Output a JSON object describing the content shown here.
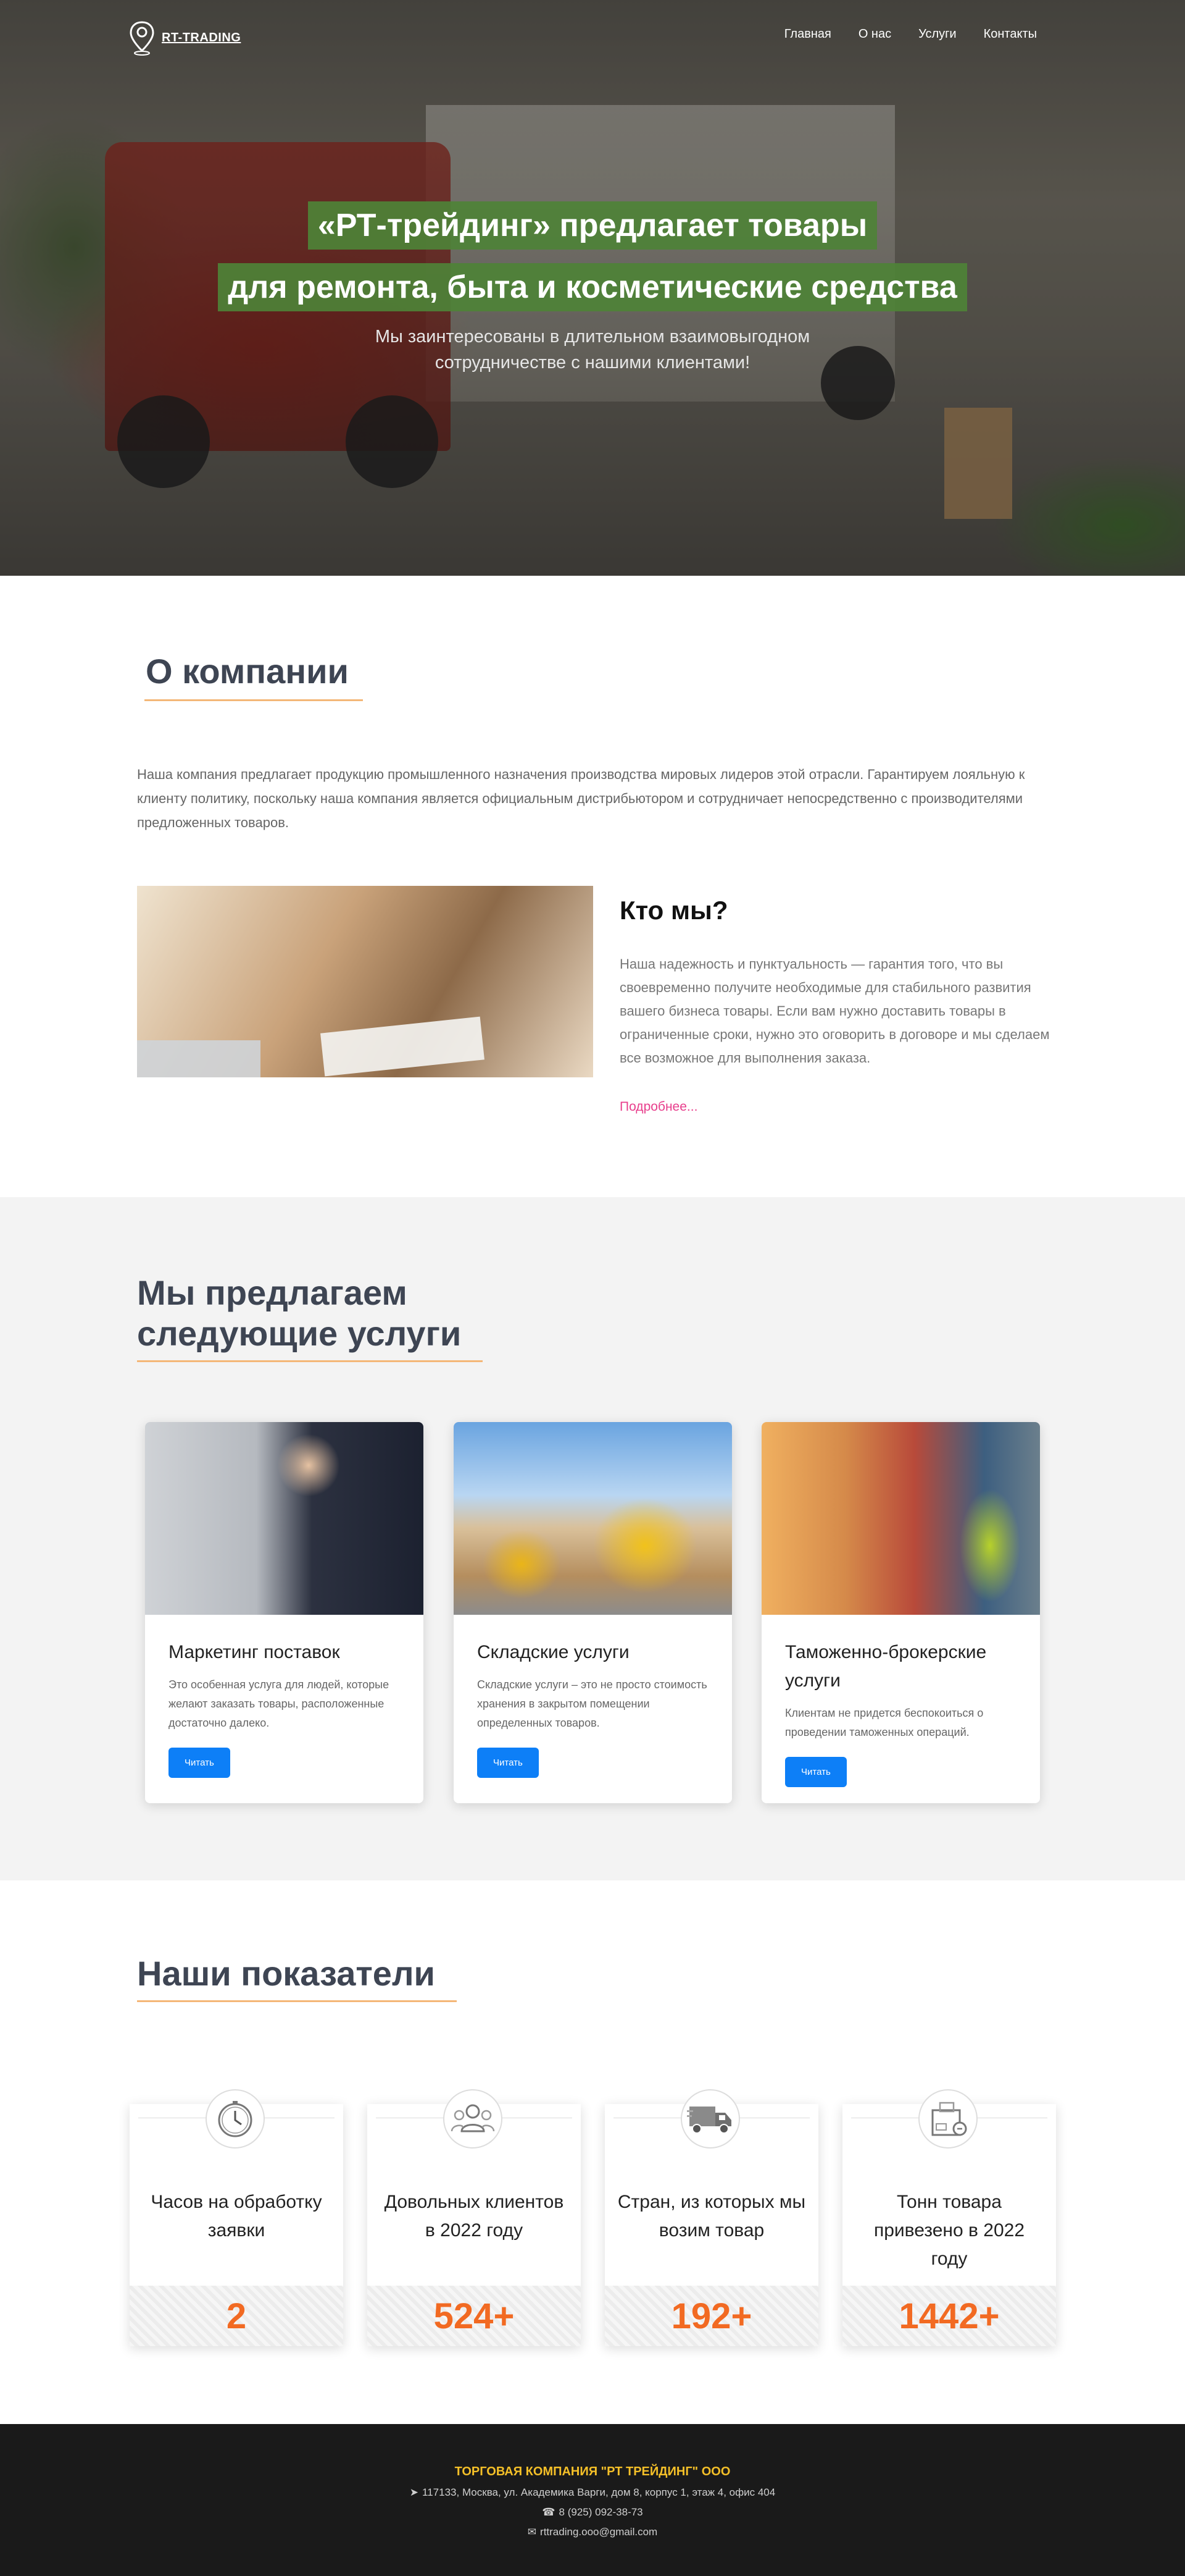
{
  "brand": {
    "name": "RT-TRADING"
  },
  "nav": {
    "items": [
      {
        "label": "Главная"
      },
      {
        "label": "О нас"
      },
      {
        "label": "Услуги"
      },
      {
        "label": "Контакты"
      }
    ]
  },
  "hero": {
    "title_line1": "«РТ-трейдинг» предлагает товары",
    "title_line2": "для ремонта, быта и косметические средства",
    "subtitle": "Мы заинтересованы в длительном взаимовыгодном сотрудничестве с нашими клиентами!"
  },
  "about": {
    "title": "О компании",
    "text": "Наша компания предлагает продукцию промышленного назначения производства мировых лидеров этой отрасли. Гарантируем лояльную к клиенту политику, поскольку наша компания является официальным дистрибьютором и сотрудничает непосредственно с производителями предложенных товаров.",
    "who_title": "Кто мы?",
    "who_text": "Наша надежность и пунктуальность — гарантия того, что вы своевременно получите необходимые для стабильного развития вашего бизнеса товары. Если вам нужно доставить товары в ограниченные сроки, нужно это оговорить в договоре и мы сделаем все возможное для выполнения заказа.",
    "more_label": "Подробнее..."
  },
  "services": {
    "title_line1": "Мы предлагаем",
    "title_line2": "следующие услуги",
    "cards": [
      {
        "title": "Маркетинг поставок",
        "text": "Это особенная услуга для людей, которые желают заказать товары, расположенные достаточно далеко.",
        "button": "Читать"
      },
      {
        "title": "Складские услуги",
        "text": "Складские услуги – это не просто стоимость хранения в закрытом помещении определенных товаров.",
        "button": "Читать"
      },
      {
        "title": "Таможенно-брокерские услуги",
        "text": "Клиентам не придется беспокоиться о проведении таможенных операций.",
        "button": "Читать"
      }
    ]
  },
  "stats": {
    "title": "Наши показатели",
    "items": [
      {
        "icon": "clock-icon",
        "label": "Часов на обработку заявки",
        "value": "2"
      },
      {
        "icon": "users-icon",
        "label": "Довольных клиентов в 2022 году",
        "value": "524+"
      },
      {
        "icon": "truck-icon",
        "label": "Стран, из которых мы возим товар",
        "value": "192+"
      },
      {
        "icon": "package-icon",
        "label": "Тонн товара привезено в 2022 году",
        "value": "1442+"
      }
    ]
  },
  "footer": {
    "company": "ТОРГОВАЯ КОМПАНИЯ \"РТ ТРЕЙДИНГ\" ООО",
    "address": "117133, Москва, ул. Академика Варги, дом 8, корпус 1, этаж 4, офис 404",
    "phone": "8 (925) 092-38-73",
    "email": "rttrading.ooo@gmail.com"
  },
  "colors": {
    "accent_green": "#4e8237",
    "underline": "#f4b777",
    "button_blue": "#0d7ff7",
    "stat_orange": "#f26a22",
    "link_pink": "#e83e8c",
    "footer_gold": "#f5c028"
  }
}
